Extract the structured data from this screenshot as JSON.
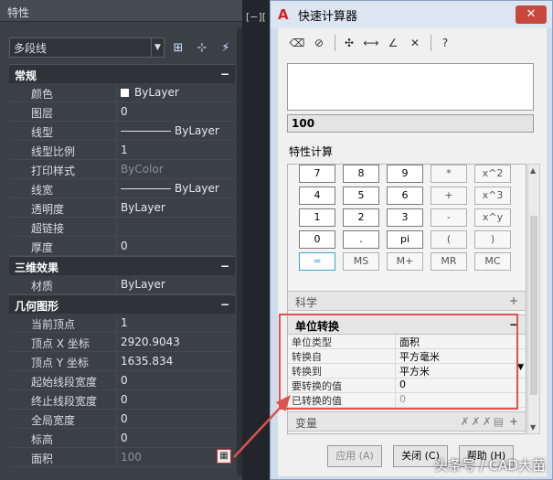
{
  "properties": {
    "title": "特性",
    "object_type": "多段线",
    "sections": [
      {
        "title": "常规",
        "collapse": "−",
        "rows": [
          {
            "label": "颜色",
            "value": "ByLayer"
          },
          {
            "label": "图层",
            "value": "0"
          },
          {
            "label": "线型",
            "value": "ByLayer"
          },
          {
            "label": "线型比例",
            "value": "1"
          },
          {
            "label": "打印样式",
            "value": "ByColor"
          },
          {
            "label": "线宽",
            "value": "ByLayer"
          },
          {
            "label": "透明度",
            "value": "ByLayer"
          },
          {
            "label": "超链接",
            "value": ""
          },
          {
            "label": "厚度",
            "value": "0"
          }
        ]
      },
      {
        "title": "三维效果",
        "collapse": "−",
        "rows": [
          {
            "label": "材质",
            "value": "ByLayer"
          }
        ]
      },
      {
        "title": "几何图形",
        "collapse": "−",
        "rows": [
          {
            "label": "当前顶点",
            "value": "1"
          },
          {
            "label": "顶点 X 坐标",
            "value": "2920.9043"
          },
          {
            "label": "顶点 Y 坐标",
            "value": "1635.834"
          },
          {
            "label": "起始线段宽度",
            "value": "0"
          },
          {
            "label": "终止线段宽度",
            "value": "0"
          },
          {
            "label": "全局宽度",
            "value": "0"
          },
          {
            "label": "标高",
            "value": "0"
          },
          {
            "label": "面积",
            "value": "100"
          }
        ]
      }
    ]
  },
  "viewport_label": "[−][",
  "quick_calc": {
    "title": "快速计算器",
    "close_symbol": "✕",
    "input_value": "100",
    "feature_label": "特性计算",
    "keys": [
      [
        "7",
        "8",
        "9",
        "*",
        "x^2"
      ],
      [
        "4",
        "5",
        "6",
        "+",
        "x^3"
      ],
      [
        "1",
        "2",
        "3",
        "-",
        "x^y"
      ],
      [
        "0",
        ".",
        "pi",
        "(",
        ")"
      ],
      [
        "=",
        "MS",
        "M+",
        "MR",
        "MC"
      ]
    ],
    "science_label": "科学",
    "science_toggle": "+",
    "unit_conversion": {
      "title": "单位转换",
      "toggle": "−",
      "rows": [
        {
          "label": "单位类型",
          "value": "面积"
        },
        {
          "label": "转换自",
          "value": "平方毫米"
        },
        {
          "label": "转换到",
          "value": "平方米"
        },
        {
          "label": "要转换的值",
          "value": "0"
        },
        {
          "label": "已转换的值",
          "value": "0"
        }
      ]
    },
    "variables_label": "变量",
    "variables_toggle": "+",
    "buttons": {
      "apply": "应用 (A)",
      "close": "关闭 (C)",
      "help": "帮助 (H)"
    }
  },
  "watermark": "头条号 / CAD大苗"
}
